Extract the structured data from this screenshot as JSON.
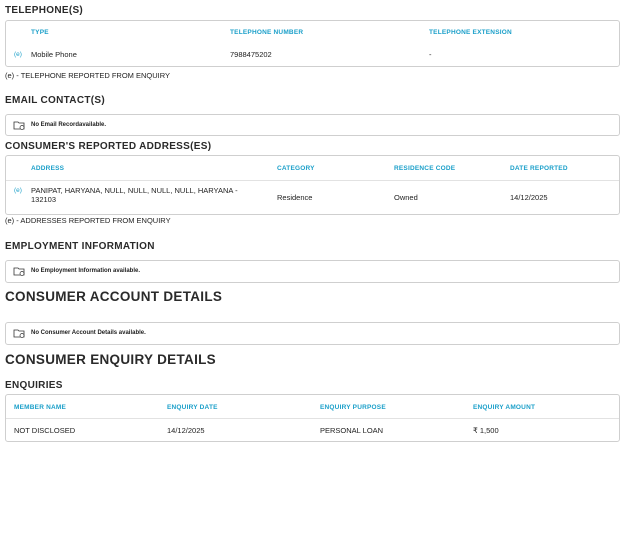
{
  "telephones": {
    "title": "TELEPHONE(S)",
    "headers": [
      "TYPE",
      "TELEPHONE NUMBER",
      "TELEPHONE EXTENSION"
    ],
    "rows": [
      {
        "marker": "(e)",
        "type": "Mobile Phone",
        "number": "7988475202",
        "extension": "-"
      }
    ],
    "note": "(e) - TELEPHONE REPORTED FROM ENQUIRY"
  },
  "emails": {
    "title": "EMAIL CONTACT(S)",
    "empty": "No Email Recordavailable."
  },
  "addresses": {
    "title": "CONSUMER'S REPORTED ADDRESS(ES)",
    "headers": [
      "ADDRESS",
      "CATEGORY",
      "RESIDENCE CODE",
      "DATE REPORTED"
    ],
    "rows": [
      {
        "marker": "(e)",
        "address": "PANIPAT, HARYANA, NULL, NULL, NULL, NULL, HARYANA - 132103",
        "category": "Residence",
        "residence_code": "Owned",
        "date": "14/12/2025"
      }
    ],
    "note": "(e) - ADDRESSES REPORTED FROM ENQUIRY"
  },
  "employment": {
    "title": "EMPLOYMENT INFORMATION",
    "empty": "No Employment Information available."
  },
  "accounts": {
    "title": "CONSUMER ACCOUNT DETAILS",
    "empty": "No Consumer Account Details available."
  },
  "enquiry": {
    "title": "CONSUMER ENQUIRY DETAILS",
    "subtitle": "ENQUIRIES",
    "headers": [
      "MEMBER NAME",
      "ENQUIRY DATE",
      "ENQUIRY PURPOSE",
      "ENQUIRY AMOUNT"
    ],
    "rows": [
      {
        "member": "NOT DISCLOSED",
        "date": "14/12/2025",
        "purpose": "PERSONAL LOAN",
        "amount": "₹ 1,500"
      }
    ]
  },
  "colors": {
    "accent": "#1a9fc9"
  }
}
